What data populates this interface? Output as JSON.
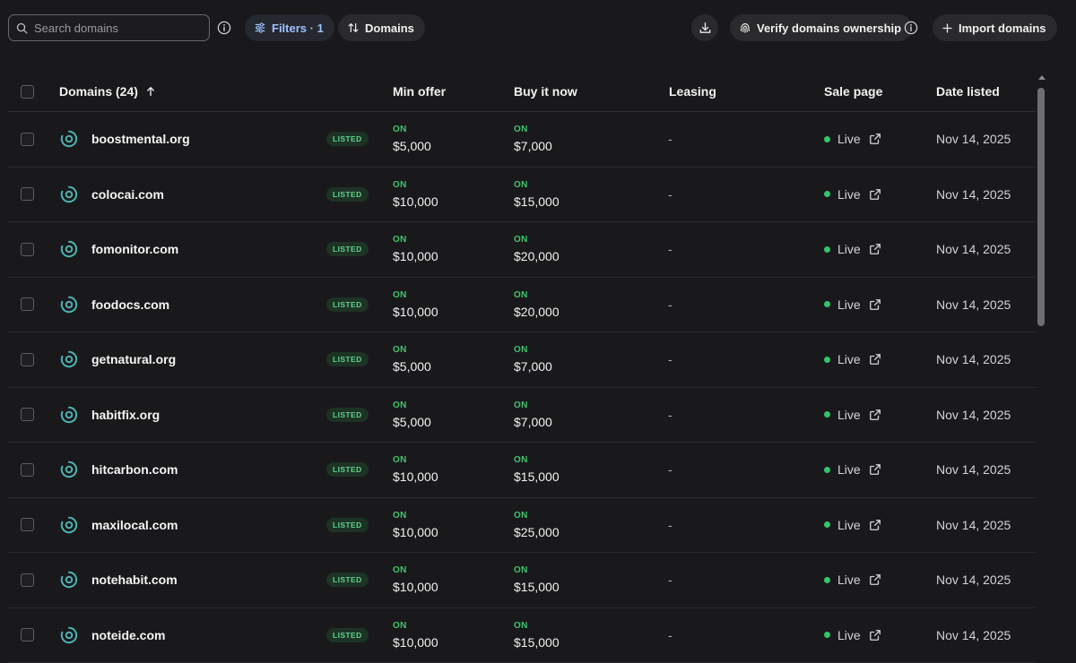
{
  "toolbar": {
    "search_placeholder": "Search domains",
    "filters_label": "Filters · 1",
    "domains_label": "Domains",
    "verify_label": "Verify domains ownership",
    "import_label": "Import domains"
  },
  "table": {
    "headers": {
      "domains": "Domains (24)",
      "min_offer": "Min offer",
      "buy_now": "Buy it now",
      "leasing": "Leasing",
      "sale_page": "Sale page",
      "date_listed": "Date listed"
    },
    "rows": [
      {
        "domain": "boostmental.org",
        "status": "LISTED",
        "min_status": "ON",
        "min_offer": "$5,000",
        "buy_status": "ON",
        "buy_now": "$7,000",
        "leasing": "-",
        "sale_page": "Live",
        "date": "Nov 14, 2025"
      },
      {
        "domain": "colocai.com",
        "status": "LISTED",
        "min_status": "ON",
        "min_offer": "$10,000",
        "buy_status": "ON",
        "buy_now": "$15,000",
        "leasing": "-",
        "sale_page": "Live",
        "date": "Nov 14, 2025"
      },
      {
        "domain": "fomonitor.com",
        "status": "LISTED",
        "min_status": "ON",
        "min_offer": "$10,000",
        "buy_status": "ON",
        "buy_now": "$20,000",
        "leasing": "-",
        "sale_page": "Live",
        "date": "Nov 14, 2025"
      },
      {
        "domain": "foodocs.com",
        "status": "LISTED",
        "min_status": "ON",
        "min_offer": "$10,000",
        "buy_status": "ON",
        "buy_now": "$20,000",
        "leasing": "-",
        "sale_page": "Live",
        "date": "Nov 14, 2025"
      },
      {
        "domain": "getnatural.org",
        "status": "LISTED",
        "min_status": "ON",
        "min_offer": "$5,000",
        "buy_status": "ON",
        "buy_now": "$7,000",
        "leasing": "-",
        "sale_page": "Live",
        "date": "Nov 14, 2025"
      },
      {
        "domain": "habitfix.org",
        "status": "LISTED",
        "min_status": "ON",
        "min_offer": "$5,000",
        "buy_status": "ON",
        "buy_now": "$7,000",
        "leasing": "-",
        "sale_page": "Live",
        "date": "Nov 14, 2025"
      },
      {
        "domain": "hitcarbon.com",
        "status": "LISTED",
        "min_status": "ON",
        "min_offer": "$10,000",
        "buy_status": "ON",
        "buy_now": "$15,000",
        "leasing": "-",
        "sale_page": "Live",
        "date": "Nov 14, 2025"
      },
      {
        "domain": "maxilocal.com",
        "status": "LISTED",
        "min_status": "ON",
        "min_offer": "$10,000",
        "buy_status": "ON",
        "buy_now": "$25,000",
        "leasing": "-",
        "sale_page": "Live",
        "date": "Nov 14, 2025"
      },
      {
        "domain": "notehabit.com",
        "status": "LISTED",
        "min_status": "ON",
        "min_offer": "$10,000",
        "buy_status": "ON",
        "buy_now": "$15,000",
        "leasing": "-",
        "sale_page": "Live",
        "date": "Nov 14, 2025"
      },
      {
        "domain": "noteide.com",
        "status": "LISTED",
        "min_status": "ON",
        "min_offer": "$10,000",
        "buy_status": "ON",
        "buy_now": "$15,000",
        "leasing": "-",
        "sale_page": "Live",
        "date": "Nov 14, 2025"
      }
    ]
  },
  "colors": {
    "background": "#19191b",
    "accent_green": "#3fc46f",
    "domain_icon": "#4fb3b3",
    "filter_accent": "#9cc2ff"
  },
  "icons": {
    "search": "search-icon",
    "info": "info-icon",
    "filters": "sliders-icon",
    "sort": "sort-arrows-icon",
    "download": "download-icon",
    "verify": "fingerprint-icon",
    "import": "plus-icon",
    "domain": "target-ring-icon",
    "external": "external-link-icon",
    "sort_direction": "arrow-up-icon"
  }
}
